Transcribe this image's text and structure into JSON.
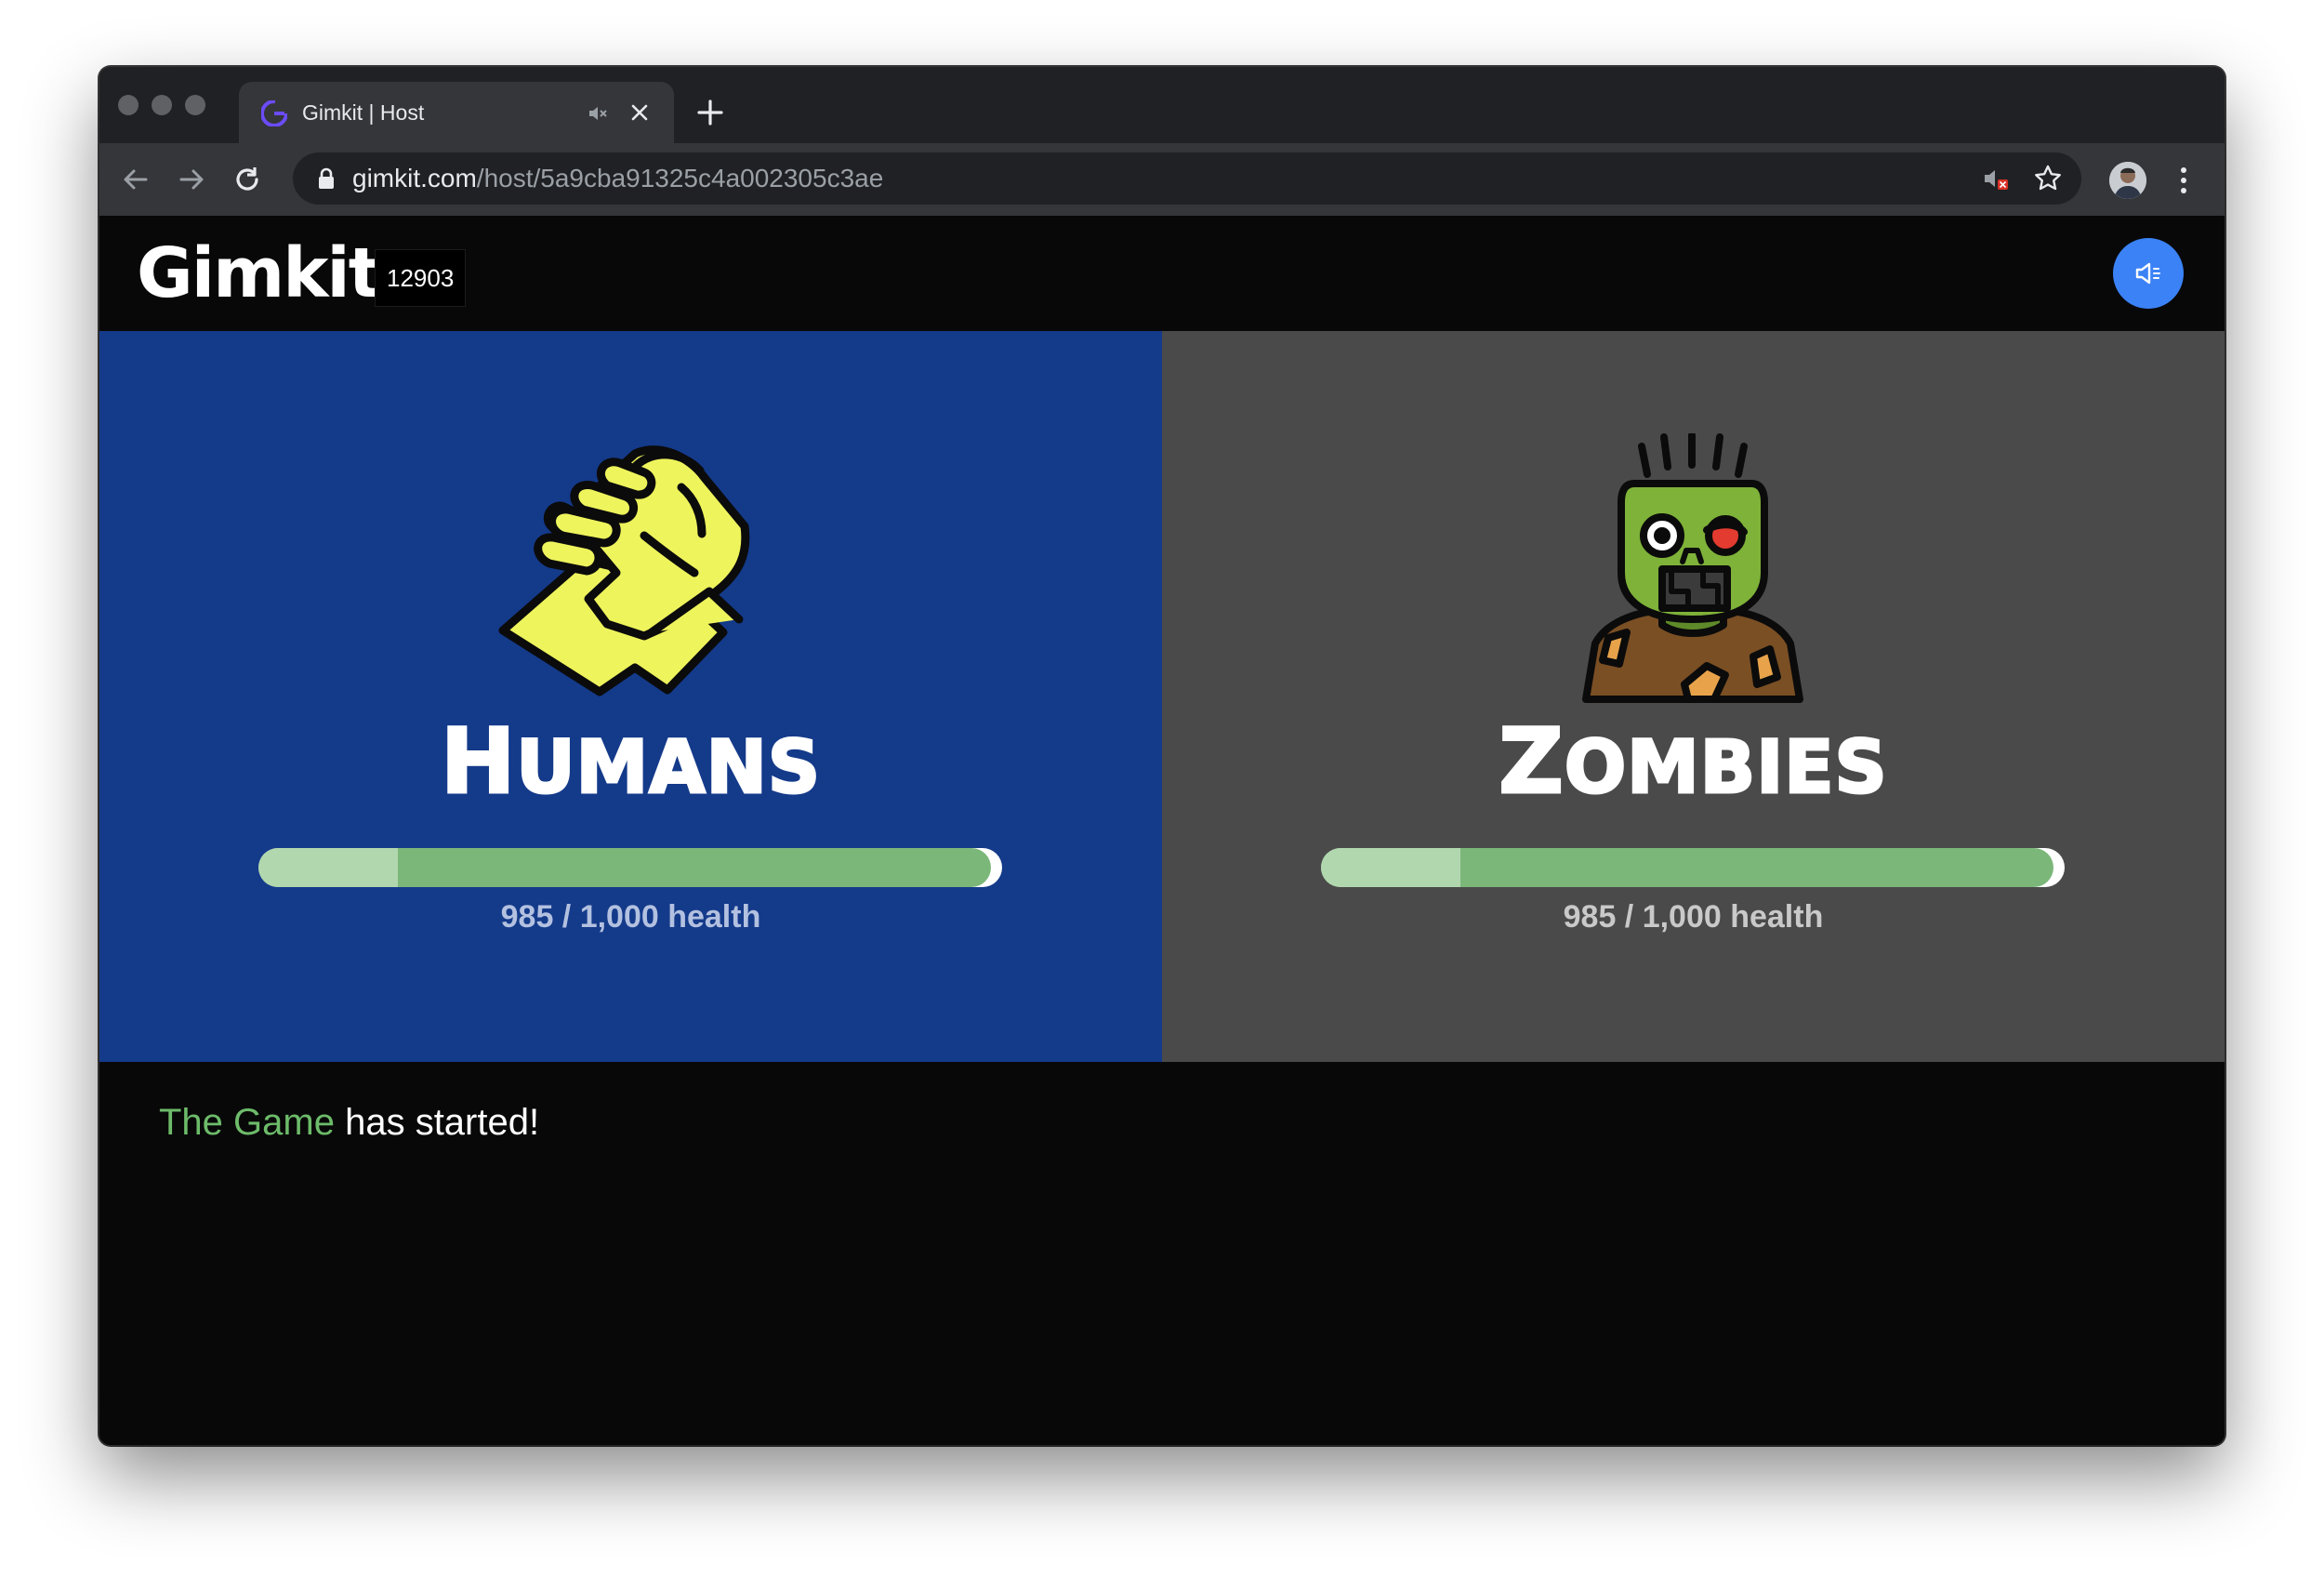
{
  "browser": {
    "tab": {
      "title": "Gimkit | Host",
      "favicon": "gimkit-g-icon",
      "muted": true
    },
    "new_tab_icon": "plus-icon",
    "address": {
      "domain": "gimkit.com",
      "path": "/host/5a9cba91325c4a002305c3ae"
    },
    "nav_icons": [
      "back-arrow-icon",
      "forward-arrow-icon",
      "reload-icon"
    ],
    "right_icons": [
      "sound-blocked-icon",
      "bookmark-star-icon",
      "profile-avatar",
      "more-menu-icon"
    ]
  },
  "header": {
    "logo": "Gimkit",
    "game_code": "12903",
    "sound_button_icon": "speaker-icon",
    "accent": "#3b82f6"
  },
  "teams": [
    {
      "name_first": "H",
      "name_rest": "UMANS",
      "icon": "handshake-icon",
      "health_current": 985,
      "health_max": 1000,
      "health_text": "985 / 1,000 health",
      "bg_color": "#143a8a"
    },
    {
      "name_first": "Z",
      "name_rest": "OMBIES",
      "icon": "zombie-icon",
      "health_current": 985,
      "health_max": 1000,
      "health_text": "985 / 1,000 health",
      "bg_color": "#4a4a4a"
    }
  ],
  "log": {
    "highlight": "The Game",
    "rest": " has started!",
    "highlight_color": "#6dbb6a"
  }
}
